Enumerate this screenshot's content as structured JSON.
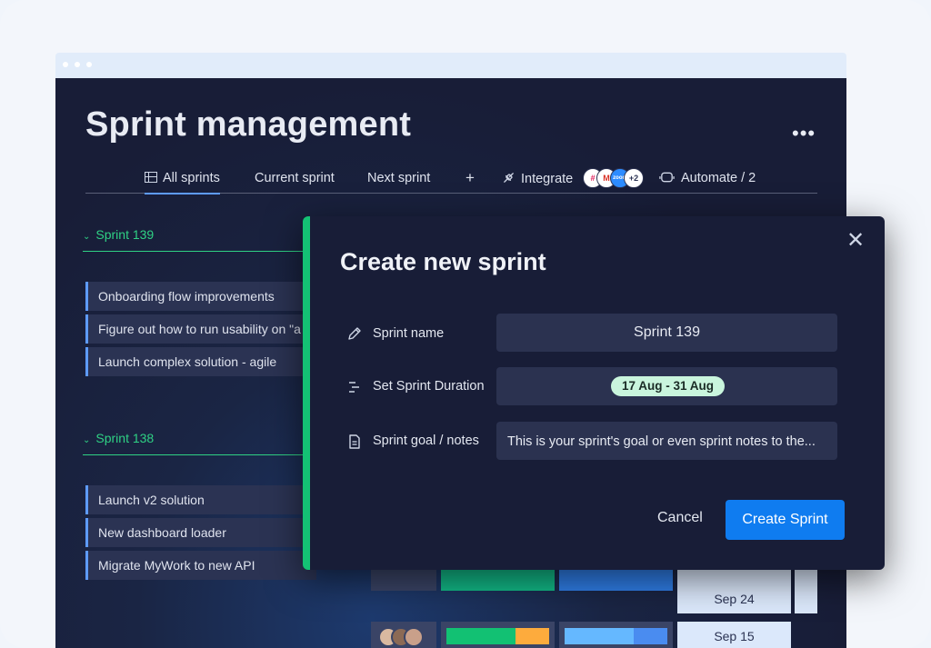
{
  "page": {
    "title": "Sprint management",
    "more_icon": "more-horizontal-icon",
    "more_glyph": "•••"
  },
  "tabs": [
    {
      "label": "All sprints",
      "icon": "table-icon",
      "active": true
    },
    {
      "label": "Current sprint"
    },
    {
      "label": "Next sprint"
    },
    {
      "label": "+"
    },
    {
      "label": "Integrate",
      "icon": "integrate-icon"
    },
    {
      "label": "Automate / 2",
      "icon": "robot-icon"
    }
  ],
  "integrations": {
    "logos": [
      "slack-icon",
      "gmail-icon",
      "zoom-icon"
    ],
    "logo_text": [
      "#",
      "M",
      "zoom"
    ],
    "more_count": "+2"
  },
  "groups": [
    {
      "name": "Sprint 139",
      "chevron": "⌄",
      "items": [
        "Onboarding flow improvements",
        "Figure out how to run usability on \"a",
        "Launch complex solution - agile"
      ]
    },
    {
      "name": "Sprint 138",
      "chevron": "⌄",
      "items": [
        "Launch v2 solution",
        "New dashboard loader",
        "Migrate MyWork to new API"
      ]
    }
  ],
  "background_cells": {
    "dates": [
      "Sep 24",
      "Sep 15"
    ]
  },
  "modal": {
    "title": "Create new sprint",
    "close_glyph": "✕",
    "fields": [
      {
        "label": "Sprint name",
        "icon": "pencil-icon",
        "value": "Sprint 139"
      },
      {
        "label": "Set Sprint Duration",
        "icon": "timeline-icon",
        "value": "17 Aug - 31 Aug"
      },
      {
        "label": "Sprint goal / notes",
        "icon": "document-icon",
        "value": "This is your sprint's goal or even sprint notes to the..."
      }
    ],
    "cancel_label": "Cancel",
    "create_label": "Create Sprint"
  },
  "colors": {
    "accent_green": "#14c174",
    "primary_blue": "#0f7cf0",
    "board_bg": "#181d37",
    "row_bg": "#2b3353"
  }
}
